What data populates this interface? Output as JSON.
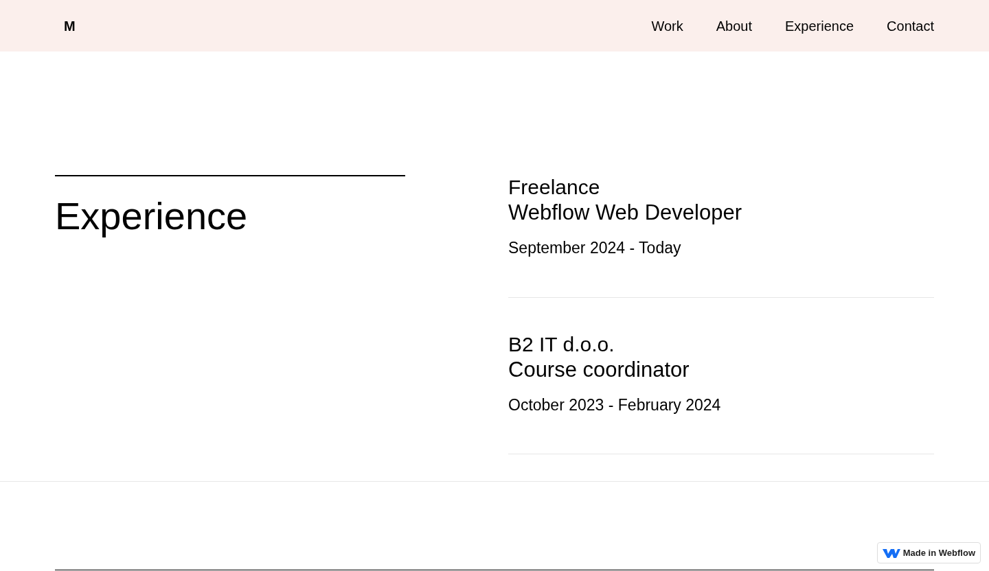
{
  "header": {
    "logo": "M",
    "nav": [
      {
        "label": "Work"
      },
      {
        "label": "About"
      },
      {
        "label": "Experience"
      },
      {
        "label": "Contact"
      }
    ]
  },
  "section": {
    "title": "Experience",
    "items": [
      {
        "company": "Freelance",
        "role": "Webflow Web Developer",
        "period": "September 2024 - Today"
      },
      {
        "company": "B2 IT d.o.o.",
        "role": "Course coordinator",
        "period": "October 2023 - February 2024"
      }
    ]
  },
  "badge": {
    "label": "Made in Webflow"
  }
}
